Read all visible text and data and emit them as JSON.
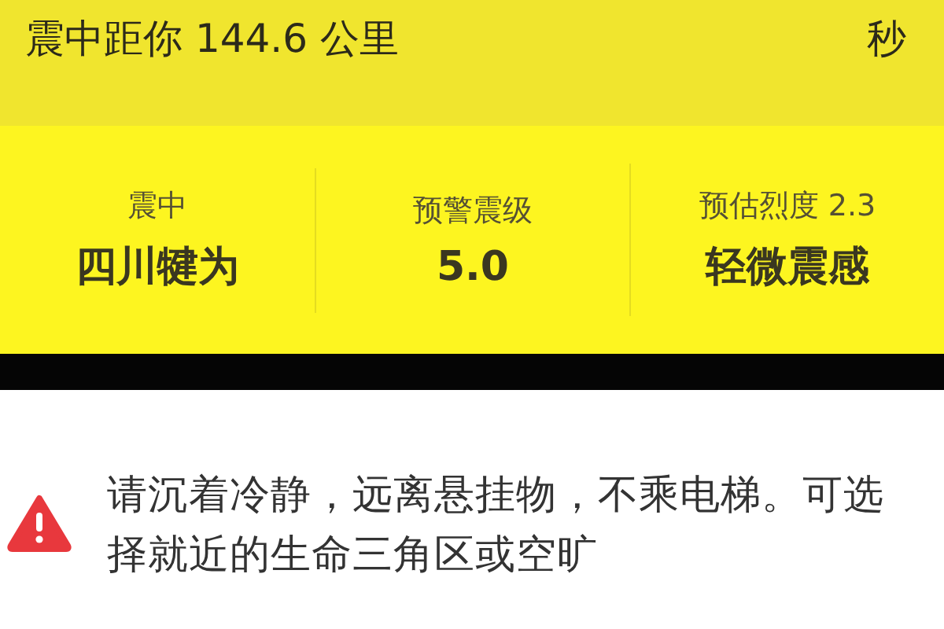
{
  "header": {
    "title": "震中距你 144.6 公里",
    "right": "秒"
  },
  "stats": [
    {
      "label": "震中",
      "value": "四川犍为"
    },
    {
      "label": "预警震级",
      "value": "5.0"
    },
    {
      "label": "预估烈度 2.3",
      "value": "轻微震感"
    }
  ],
  "advice": {
    "text": "请沉着冷静，远离悬挂物，不乘电梯。可选择就近的生命三角区或空旷"
  }
}
